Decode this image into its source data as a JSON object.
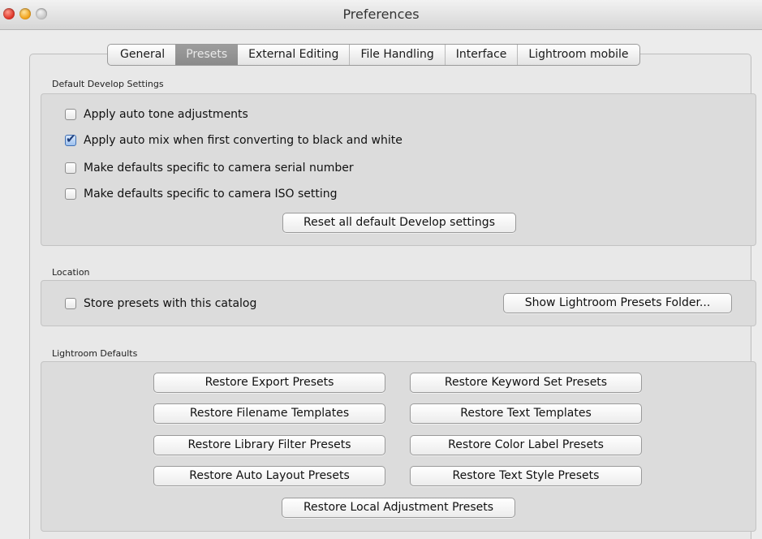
{
  "window": {
    "title": "Preferences"
  },
  "tabs": [
    {
      "label": "General",
      "active": false
    },
    {
      "label": "Presets",
      "active": true
    },
    {
      "label": "External Editing",
      "active": false
    },
    {
      "label": "File Handling",
      "active": false
    },
    {
      "label": "Interface",
      "active": false
    },
    {
      "label": "Lightroom mobile",
      "active": false
    }
  ],
  "develop": {
    "label": "Default Develop Settings",
    "options": [
      {
        "label": "Apply auto tone adjustments",
        "checked": false
      },
      {
        "label": "Apply auto mix when first converting to black and white",
        "checked": true
      },
      {
        "label": "Make defaults specific to camera serial number",
        "checked": false
      },
      {
        "label": "Make defaults specific to camera ISO setting",
        "checked": false
      }
    ],
    "reset_button": "Reset all default Develop settings"
  },
  "location": {
    "label": "Location",
    "store_option": {
      "label": "Store presets with this catalog",
      "checked": false
    },
    "show_folder_button": "Show Lightroom Presets Folder..."
  },
  "defaults": {
    "label": "Lightroom Defaults",
    "buttons": [
      "Restore Export Presets",
      "Restore Keyword Set Presets",
      "Restore Filename Templates",
      "Restore Text Templates",
      "Restore Library Filter Presets",
      "Restore Color Label Presets",
      "Restore Auto Layout Presets",
      "Restore Text Style Presets",
      "Restore Local Adjustment Presets"
    ]
  }
}
